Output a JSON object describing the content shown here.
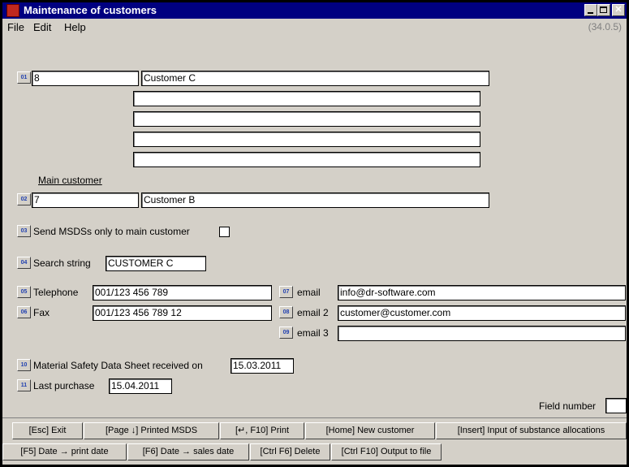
{
  "window": {
    "title": "Maintenance of customers",
    "version": "(34.0.5)"
  },
  "menu": [
    "File",
    "Edit",
    "Help"
  ],
  "field_numbers": [
    "01",
    "02",
    "03",
    "04",
    "05",
    "06",
    "07",
    "08",
    "09",
    "10",
    "11"
  ],
  "customer": {
    "number": "8",
    "name": "Customer C",
    "address_lines": [
      "",
      "",
      "",
      ""
    ]
  },
  "main_customer": {
    "label": "Main customer",
    "number": "7",
    "name": "Customer B"
  },
  "msds_only_main": {
    "label": "Send MSDSs only to main customer",
    "checked": false
  },
  "search_string": {
    "label": "Search string",
    "value": "CUSTOMER C"
  },
  "contact": {
    "telephone": {
      "label": "Telephone",
      "value": "001/123 456 789"
    },
    "fax": {
      "label": "Fax",
      "value": "001/123 456 789 12"
    },
    "email": {
      "label": "email",
      "value": "info@dr-software.com"
    },
    "email2": {
      "label": "email 2",
      "value": "customer@customer.com"
    },
    "email3": {
      "label": "email 3",
      "value": ""
    }
  },
  "msds_received": {
    "label": "Material Safety Data Sheet received on",
    "value": "15.03.2011"
  },
  "last_purchase": {
    "label": "Last purchase",
    "value": "15.04.2011"
  },
  "field_number": {
    "label": "Field number",
    "value": ""
  },
  "buttons_row1": [
    "[Esc] Exit",
    "[Page ↓] Printed MSDS",
    "[↵, F10] Print",
    "[Home] New customer",
    "[Insert] Input of substance allocations"
  ],
  "buttons_row2": [
    "[F5] Date → print date",
    "[F6] Date → sales date",
    "[Ctrl F6] Delete",
    "[Ctrl F10] Output to file"
  ],
  "colors": {
    "titlebar": "#000080",
    "window": "#d4d0c8",
    "field_number_text": "#1f3fb0",
    "app_icon": "#c0281e"
  }
}
